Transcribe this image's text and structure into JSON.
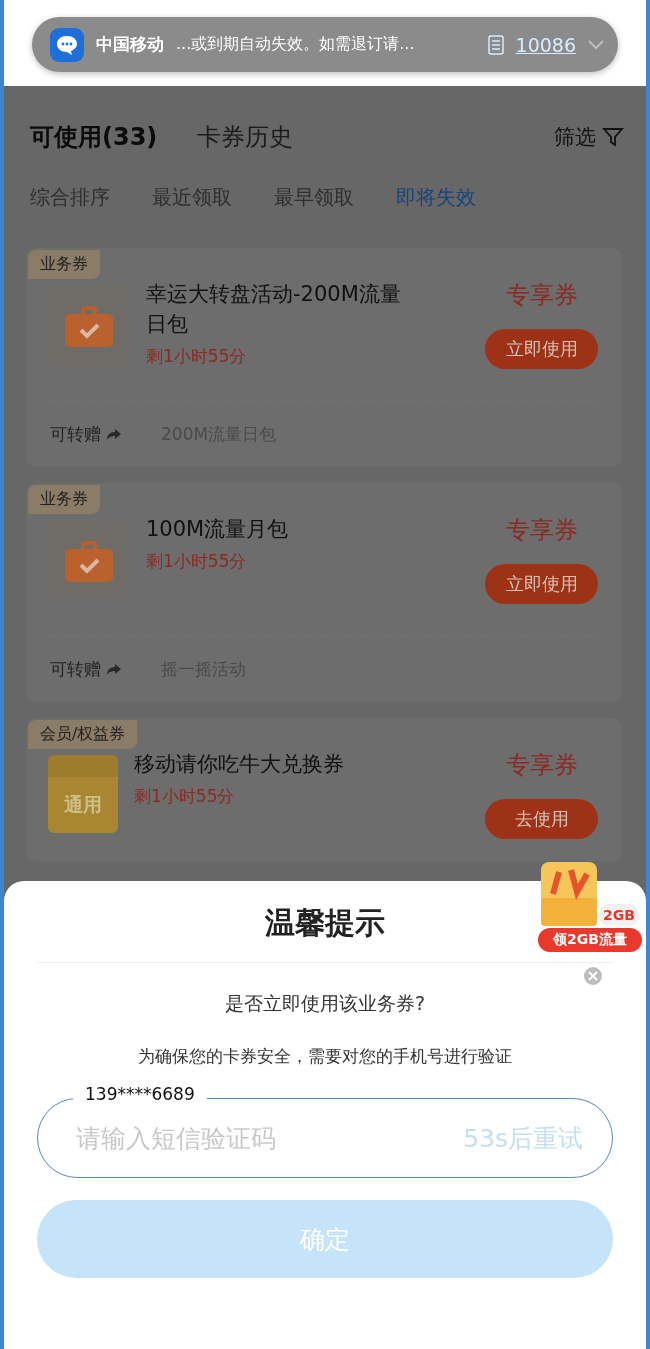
{
  "notification": {
    "app": "中国移动",
    "message": "...或到期自动失效。如需退订请...",
    "number": "10086"
  },
  "tabs": [
    {
      "label": "可使用(33)",
      "selected": true
    },
    {
      "label": "卡券历史",
      "selected": false
    }
  ],
  "filter": "筛选",
  "sort_options": [
    {
      "label": "综合排序",
      "selected": false
    },
    {
      "label": "最近领取",
      "selected": false
    },
    {
      "label": "最早领取",
      "selected": false
    },
    {
      "label": "即将失效",
      "selected": true
    }
  ],
  "coupons": [
    {
      "tag": "业务券",
      "icon": {
        "kind": "bag"
      },
      "title": "幸运大转盘活动-200M流量日包",
      "remaining": "剩1小时55分",
      "type": "专享券",
      "action": "立即使用",
      "transfer": "可转赠",
      "source": "200M流量日包"
    },
    {
      "tag": "业务券",
      "icon": {
        "kind": "bag"
      },
      "title": "100M流量月包",
      "remaining": "剩1小时55分",
      "type": "专享券",
      "action": "立即使用",
      "transfer": "可转赠",
      "source": "摇一摇活动"
    },
    {
      "tag": "会员/权益券",
      "icon": {
        "kind": "ticket",
        "label": "通用"
      },
      "title": "移动请你吃牛大兑换券",
      "remaining": "剩1小时55分",
      "type": "专享券",
      "action": "去使用"
    }
  ],
  "promo": {
    "amount": "2GB",
    "label": "领2GB流量"
  },
  "dialog": {
    "title": "温馨提示",
    "question": "是否立即使用该业务券?",
    "notice": "为确保您的卡券安全，需要对您的手机号进行验证",
    "phone": "139****6689",
    "placeholder": "请输入短信验证码",
    "countdown": "53s后重试",
    "confirm": {
      "label": "确定",
      "disabled": true
    }
  }
}
